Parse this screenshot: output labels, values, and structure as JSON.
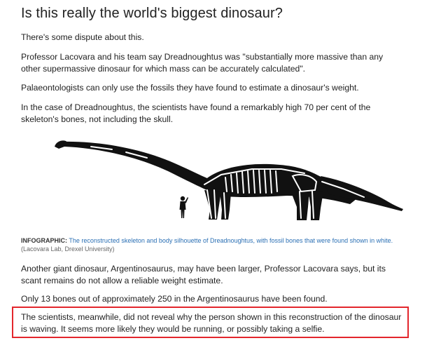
{
  "article": {
    "headline": "Is this really the world's biggest dinosaur?",
    "paragraphs": [
      "There's some dispute about this.",
      "Professor Lacovara and his team say Dreadnoughtus was \"substantially more massive than any other supermassive dinosaur for which mass can be accurately calculated\".",
      "Palaeontologists can only use the fossils they have found to estimate a dinosaur's weight.",
      "In the case of Dreadnoughtus, the scientists have found a remarkably high 70 per cent of the skeleton's bones, not including the skull.",
      "Another giant dinosaur, Argentinosaurus, may have been larger, Professor Lacovara says, but its scant remains do not allow a reliable weight estimate.",
      "Only 13 bones out of approximately 250 in the Argentinosaurus have been found.",
      "The scientists, meanwhile, did not reveal why the person shown in this reconstruction of the dinosaur is waving. It seems more likely they would be running, or possibly taking a selfie."
    ],
    "caption": {
      "label": "INFOGRAPHIC:",
      "text": "The reconstructed skeleton and body silhouette of Dreadnoughtus, with fossil bones that were found shown in white.",
      "credit": "(Lacovara Lab, Drexel University)"
    }
  },
  "colors": {
    "highlight_border": "#e3262c",
    "caption_link": "#2a6fb4",
    "text": "#222222",
    "silhouette": "#111111"
  }
}
